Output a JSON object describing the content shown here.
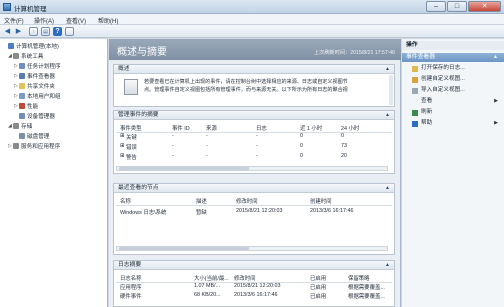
{
  "window": {
    "title": "计算机管理",
    "min": "–",
    "max": "□",
    "close": "✕"
  },
  "menubar": [
    "文件(F)",
    "操作(A)",
    "查看(V)",
    "帮助(H)"
  ],
  "toolbar": {
    "back": "◀",
    "forward": "▶",
    "up": "↑",
    "view": "▤",
    "help": "?"
  },
  "tree": [
    {
      "label": "计算机管理(本地)",
      "depth": 0,
      "toggle": "",
      "icon": "computer-icon",
      "color": "#4a7fc1"
    },
    {
      "label": "系统工具",
      "depth": 1,
      "toggle": "◢",
      "icon": "toolbox-icon",
      "color": "#8a8a8a"
    },
    {
      "label": "任务计划程序",
      "depth": 2,
      "toggle": "▷",
      "icon": "clock-icon",
      "color": "#6b8fc4"
    },
    {
      "label": "事件查看器",
      "depth": 2,
      "toggle": "▷",
      "icon": "event-viewer-icon",
      "color": "#5a7db0"
    },
    {
      "label": "共享文件夹",
      "depth": 2,
      "toggle": "▷",
      "icon": "shared-folder-icon",
      "color": "#e4c25a"
    },
    {
      "label": "本地用户和组",
      "depth": 2,
      "toggle": "▷",
      "icon": "users-icon",
      "color": "#7a9bc9"
    },
    {
      "label": "性能",
      "depth": 2,
      "toggle": "▷",
      "icon": "performance-icon",
      "color": "#c04a3a"
    },
    {
      "label": "设备管理器",
      "depth": 2,
      "toggle": "",
      "icon": "device-manager-icon",
      "color": "#6f8fb8"
    },
    {
      "label": "存储",
      "depth": 1,
      "toggle": "◢",
      "icon": "storage-icon",
      "color": "#8a8a8a"
    },
    {
      "label": "磁盘管理",
      "depth": 2,
      "toggle": "",
      "icon": "disk-icon",
      "color": "#7b8fa8"
    },
    {
      "label": "服务和应用程序",
      "depth": 1,
      "toggle": "▷",
      "icon": "services-icon",
      "color": "#8a8a8a"
    }
  ],
  "main": {
    "title": "概述与摘要",
    "updated": "上次刷新时间：2015/8/21 17:57:46",
    "overview": {
      "header": "概述",
      "line1": "若要查看已在计算机上出现的事件，请在控制台树中选择相应的来源、日志或自定义视图节",
      "line2": "点。管理事件自定义视图包括所有管理事件，而与来源无关。以下所示为所有日志的聚合视"
    },
    "summary": {
      "header": "管理事件的摘要",
      "columns": [
        "事件类型",
        "事件 ID",
        "来源",
        "日志",
        "近 1 小时",
        "24 小时"
      ],
      "rows": [
        [
          "关键",
          "-",
          "-",
          "-",
          "0",
          "0"
        ],
        [
          "错误",
          "-",
          "-",
          "-",
          "0",
          "73"
        ],
        [
          "警告",
          "-",
          "-",
          "-",
          "0",
          "20"
        ]
      ]
    },
    "recent": {
      "header": "最近查看的节点",
      "columns": [
        "名称",
        "描述",
        "修改时间",
        "创建时间"
      ],
      "rows": [
        [
          "Windows 日志\\系统",
          "暂缺",
          "2015/8/21 12:20:03",
          "2013/3/6 16:17:46"
        ]
      ]
    },
    "logs": {
      "header": "日志摘要",
      "columns": [
        "日志名称",
        "大小(当前/最...",
        "修改时间",
        "已启用",
        "保留策略"
      ],
      "rows": [
        [
          "应用程序",
          "1.07 MB/...",
          "2015/8/21 12:20:03",
          "已启用",
          "根据需要覆盖..."
        ],
        [
          "硬件事件",
          "68 KB/20...",
          "2013/3/6 16:17:46",
          "已启用",
          "根据需要覆盖..."
        ]
      ]
    }
  },
  "actions": {
    "header": "操作",
    "group": "事件查看器",
    "items": [
      {
        "label": "打开保存的日志...",
        "icon": "folder-open-icon",
        "color": "#e0b84f",
        "arrow": ""
      },
      {
        "label": "创建自定义视图...",
        "icon": "filter-icon",
        "color": "#d9a339",
        "arrow": ""
      },
      {
        "label": "导入自定义视图...",
        "icon": "import-icon",
        "color": "#9aa6b3",
        "arrow": ""
      },
      {
        "label": "查看",
        "icon": "",
        "color": "",
        "arrow": "▶"
      },
      {
        "label": "刷新",
        "icon": "refresh-icon",
        "color": "#3a8c4a",
        "arrow": ""
      },
      {
        "label": "帮助",
        "icon": "help-icon",
        "color": "#2b6cc4",
        "arrow": "▶"
      }
    ]
  }
}
